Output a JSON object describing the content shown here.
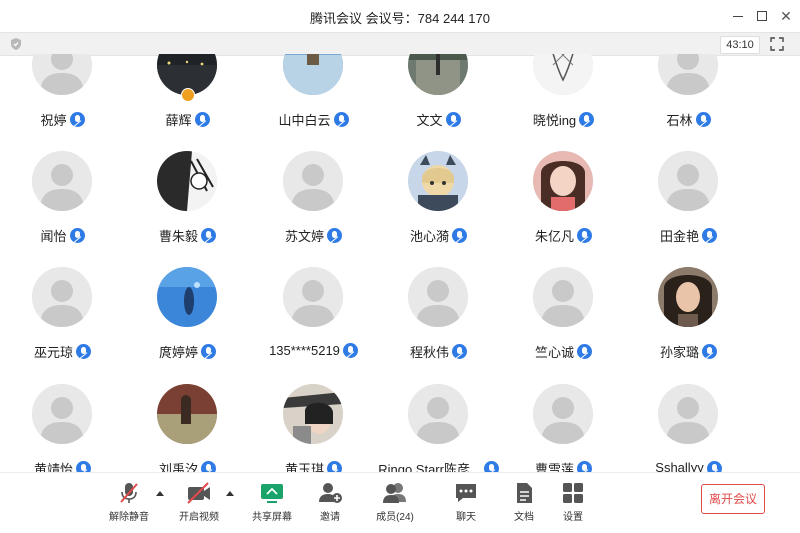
{
  "window": {
    "title": "腾讯会议 会议号：784 244 170",
    "timer": "43:10"
  },
  "participants": [
    {
      "name": "祝婷",
      "avatar": "default"
    },
    {
      "name": "薛辉",
      "avatar": "night-city",
      "host": true
    },
    {
      "name": "山中白云",
      "avatar": "lake-tree"
    },
    {
      "name": "文文",
      "avatar": "street"
    },
    {
      "name": "晓悦ing",
      "avatar": "sketch"
    },
    {
      "name": "石林",
      "avatar": "default"
    },
    {
      "name": "闻怡",
      "avatar": "default"
    },
    {
      "name": "曹朱毅",
      "avatar": "manga"
    },
    {
      "name": "苏文婷",
      "avatar": "default"
    },
    {
      "name": "池心漪",
      "avatar": "anime"
    },
    {
      "name": "朱亿凡",
      "avatar": "girl-photo"
    },
    {
      "name": "田金艳",
      "avatar": "default"
    },
    {
      "name": "巫元琼",
      "avatar": "default"
    },
    {
      "name": "庹婷婷",
      "avatar": "underwater"
    },
    {
      "name": "135****5219",
      "avatar": "default"
    },
    {
      "name": "程秋伟",
      "avatar": "default"
    },
    {
      "name": "竺心诚",
      "avatar": "default"
    },
    {
      "name": "孙家璐",
      "avatar": "woman-photo"
    },
    {
      "name": "黄靖怡",
      "avatar": "default"
    },
    {
      "name": "刘禹汐",
      "avatar": "room"
    },
    {
      "name": "黄玉琪",
      "avatar": "selfie"
    },
    {
      "name": "Ringo Starr陈彦...",
      "avatar": "default"
    },
    {
      "name": "曹雪莲",
      "avatar": "default"
    },
    {
      "name": "Sshallyy",
      "avatar": "default"
    }
  ],
  "toolbar": {
    "unmute": "解除静音",
    "video": "开启视频",
    "share": "共享屏幕",
    "invite": "邀请",
    "members": "成员(24)",
    "chat": "聊天",
    "docs": "文档",
    "settings": "设置",
    "leave": "离开会议"
  },
  "colors": {
    "accent": "#2f7be6",
    "leave": "#e04a4a",
    "share": "#1aa36b",
    "muted": "#e04a4a"
  }
}
